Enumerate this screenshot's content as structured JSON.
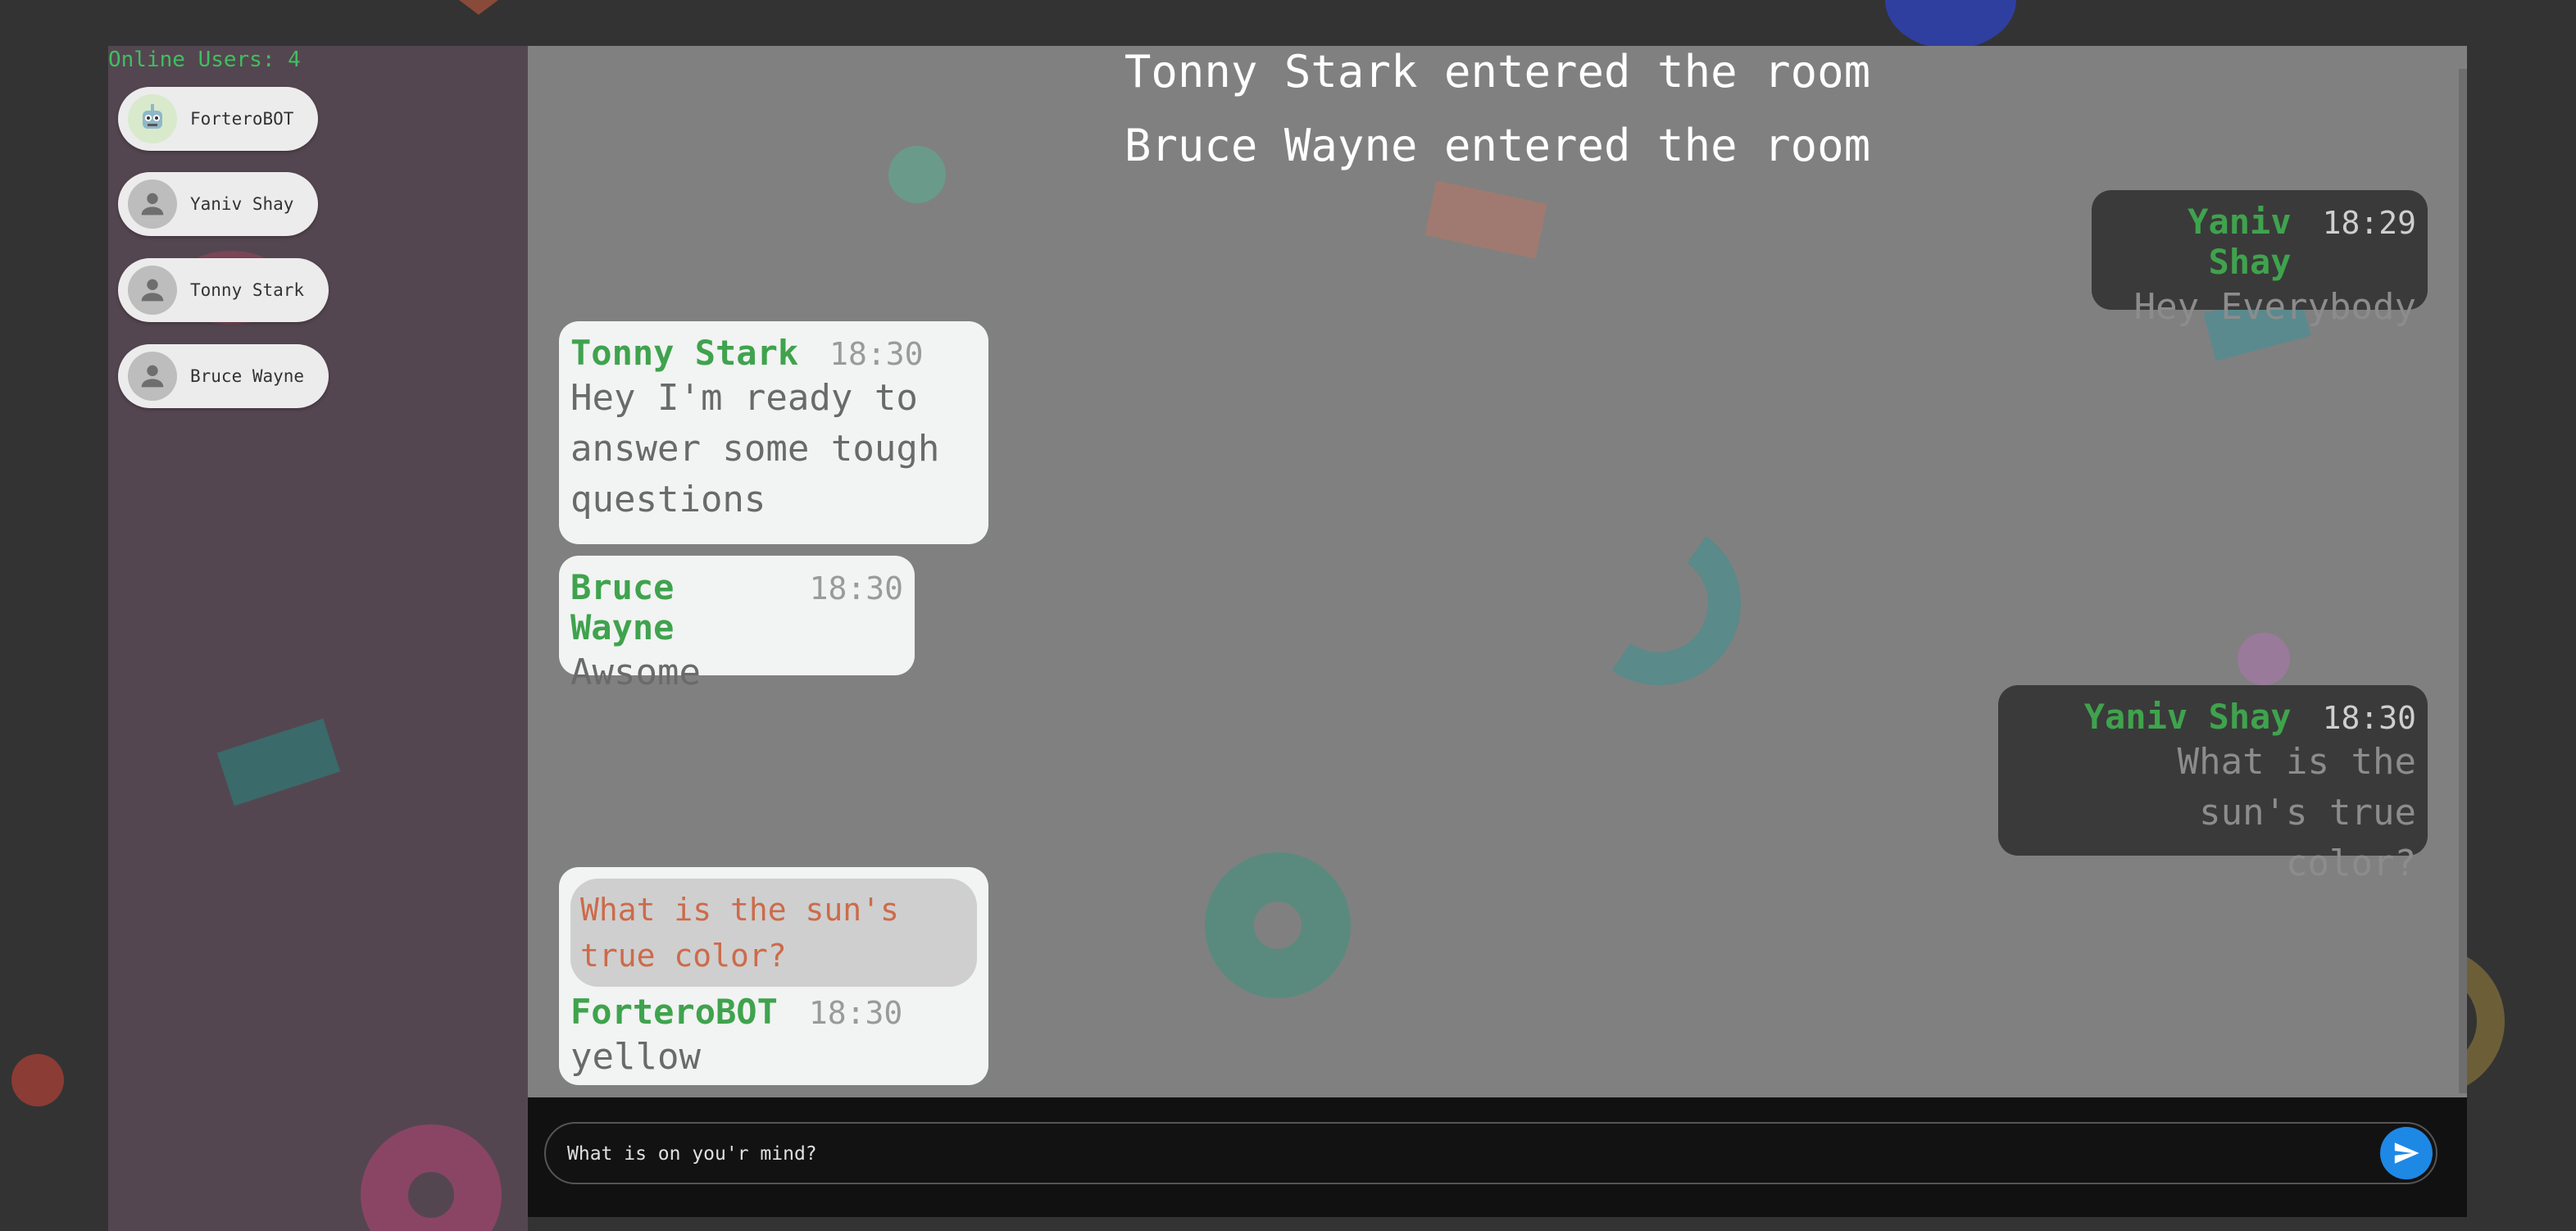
{
  "sidebar": {
    "online_label": "Online Users: 4",
    "users": [
      {
        "name": "ForteroBOT",
        "icon": "robot-avatar-icon"
      },
      {
        "name": "Yaniv Shay",
        "icon": "person-icon"
      },
      {
        "name": "Tonny Stark",
        "icon": "person-icon"
      },
      {
        "name": "Bruce Wayne",
        "icon": "person-icon"
      }
    ]
  },
  "chat": {
    "system_messages": [
      "Tonny Stark entered the room",
      "Bruce Wayne entered the room"
    ],
    "messages": [
      {
        "sender": "Yaniv Shay",
        "time": "18:29",
        "text": "Hey Everybody",
        "direction": "out"
      },
      {
        "sender": "Tonny Stark",
        "time": "18:30",
        "text": "Hey I'm ready to answer some tough questions",
        "direction": "in"
      },
      {
        "sender": "Bruce Wayne",
        "time": "18:30",
        "text": "Awsome",
        "direction": "in"
      },
      {
        "sender": "Yaniv Shay",
        "time": "18:30",
        "text": "What is the sun's true color?",
        "direction": "out"
      },
      {
        "sender": "ForteroBOT",
        "time": "18:30",
        "text": "yellow",
        "direction": "in",
        "quote": "What is the sun's true color?"
      }
    ]
  },
  "composer": {
    "placeholder": "What is on you'r mind?",
    "send_icon": "send-icon"
  },
  "colors": {
    "accent_green": "#3fa34d",
    "send_blue": "#1e88e5",
    "quote_text": "#cc6b4b"
  }
}
